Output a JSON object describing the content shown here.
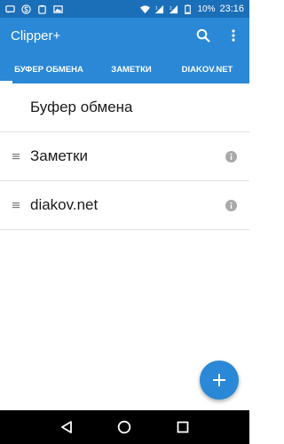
{
  "status_bar": {
    "battery": "10%",
    "time": "23:16",
    "left_icons": [
      "message-icon",
      "s-icon",
      "clipboard-icon",
      "image-icon"
    ],
    "right_icons": [
      "wifi-icon",
      "signal-1-icon",
      "signal-2-icon",
      "battery-icon"
    ]
  },
  "app_bar": {
    "title": "Clipper+",
    "actions": [
      "search-icon",
      "more-vertical-icon"
    ]
  },
  "tabs": [
    {
      "label": "Буфер обмена",
      "selected": true
    },
    {
      "label": "Заметки",
      "selected": false
    },
    {
      "label": "diakov.net",
      "selected": false
    }
  ],
  "list": {
    "items": [
      {
        "label": "Буфер обмена",
        "drag_handle": false,
        "info": false
      },
      {
        "label": "Заметки",
        "drag_handle": true,
        "info": true
      },
      {
        "label": "diakov.net",
        "drag_handle": true,
        "info": true
      }
    ]
  },
  "fab": {
    "icon": "plus-icon"
  },
  "nav_bar": {
    "buttons": [
      "back-icon",
      "home-icon",
      "recents-icon"
    ]
  },
  "colors": {
    "primary": "#2a88d6",
    "status_bar": "#1b6fb8",
    "indicator": "#ffffff",
    "nav_bar": "#000000"
  }
}
